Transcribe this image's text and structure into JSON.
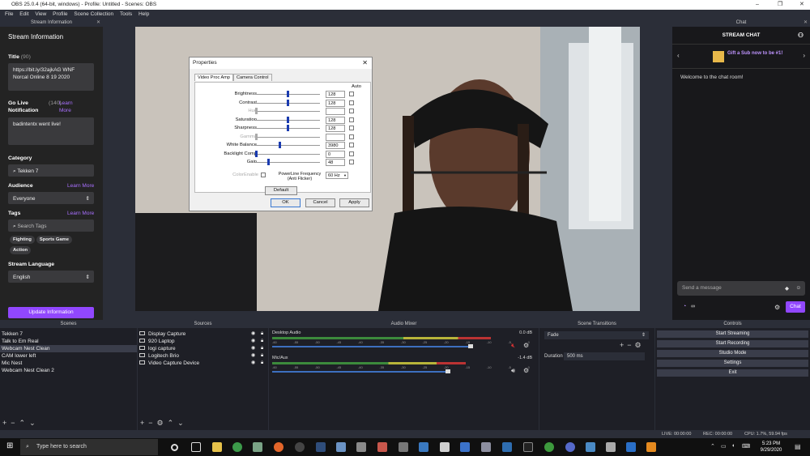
{
  "window": {
    "title": "OBS 25.0.4 (64-bit, windows) - Profile: Untitled - Scenes: OBS"
  },
  "menu": [
    "File",
    "Edit",
    "View",
    "Profile",
    "Scene Collection",
    "Tools",
    "Help"
  ],
  "stream_info": {
    "dock_title": "Stream Information",
    "heading": "Stream Information",
    "title_label": "Title",
    "title_count": "(90)",
    "title_value": "https://bit.ly/32ajkAG WNF Norcal Online 8 19 2020",
    "notif_label": "Go Live Notification",
    "notif_count": "(140)",
    "notif_learn": "Learn More",
    "notif_value": "badintentx went live!",
    "category_label": "Category",
    "category_value": "Tekken 7",
    "audience_label": "Audience",
    "audience_learn": "Learn More",
    "audience_value": "Everyone",
    "tags_label": "Tags",
    "tags_learn": "Learn More",
    "tags_placeholder": "Search Tags",
    "tags": [
      "Fighting",
      "Sports Game",
      "Action"
    ],
    "language_label": "Stream Language",
    "language_value": "English",
    "update_button": "Update Information"
  },
  "dialog": {
    "title": "Properties",
    "tabs": [
      "Video Proc Amp",
      "Camera Control"
    ],
    "auto_label": "Auto",
    "rows": [
      {
        "label": "Brightness",
        "value": "128",
        "level": 0.5,
        "enabled": true
      },
      {
        "label": "Contrast",
        "value": "128",
        "level": 0.5,
        "enabled": true
      },
      {
        "label": "Hue",
        "value": "",
        "level": 0.0,
        "enabled": false
      },
      {
        "label": "Saturation",
        "value": "128",
        "level": 0.5,
        "enabled": true
      },
      {
        "label": "Sharpness",
        "value": "128",
        "level": 0.5,
        "enabled": true
      },
      {
        "label": "Gamma",
        "value": "",
        "level": 0.0,
        "enabled": false
      },
      {
        "label": "White Balance",
        "value": "3980",
        "level": 0.37,
        "enabled": true
      },
      {
        "label": "Backlight Comp",
        "value": "0",
        "level": 0.0,
        "enabled": true
      },
      {
        "label": "Gain",
        "value": "48",
        "level": 0.19,
        "enabled": true
      }
    ],
    "color_enable": "ColorEnable",
    "powerline_label": "PowerLine Frequency (Anti Flicker)",
    "powerline_value": "60 Hz",
    "default_button": "Default",
    "ok_button": "OK",
    "cancel_button": "Cancel",
    "apply_button": "Apply"
  },
  "chat": {
    "dock_title": "Chat",
    "header": "STREAM CHAT",
    "gift_text": "Gift a Sub now to be #1!",
    "welcome": "Welcome to the chat room!",
    "input_placeholder": "Send a message",
    "points": "∞",
    "chat_button": "Chat"
  },
  "scenes": {
    "title": "Scenes",
    "items": [
      "Tekken 7",
      "Talk to Em Real",
      "Webcam Nest Clean",
      "CAM lower left",
      "Mic Nest",
      "Webcam Nest Clean 2"
    ],
    "selected": 2
  },
  "sources": {
    "title": "Sources",
    "items": [
      "Display Capture",
      "920 Laptop",
      "logi capture",
      "Logitech Brio",
      "Video Capture Device"
    ]
  },
  "mixer": {
    "title": "Audio Mixer",
    "channels": [
      {
        "name": "Desktop Audio",
        "db": "0.0 dB",
        "level": 0.85,
        "muted": true
      },
      {
        "name": "Mic/Aux",
        "db": "-1.4 dB",
        "level": 0.75,
        "muted": false
      }
    ],
    "ticks": [
      "-60",
      "-55",
      "-50",
      "-45",
      "-40",
      "-35",
      "-30",
      "-25",
      "-20",
      "-15",
      "-10",
      "-5",
      "0"
    ]
  },
  "transitions": {
    "title": "Scene Transitions",
    "value": "Fade",
    "duration_label": "Duration",
    "duration_value": "500 ms"
  },
  "controls": {
    "title": "Controls",
    "buttons": [
      "Start Streaming",
      "Start Recording",
      "Studio Mode",
      "Settings",
      "Exit"
    ]
  },
  "status": {
    "live": "LIVE: 00:00:00",
    "rec": "REC: 00:00:00",
    "cpu": "CPU: 1.7%, 59.94 fps"
  },
  "taskbar": {
    "search_placeholder": "Type here to search",
    "time": "5:23 PM",
    "date": "9/29/2020"
  }
}
